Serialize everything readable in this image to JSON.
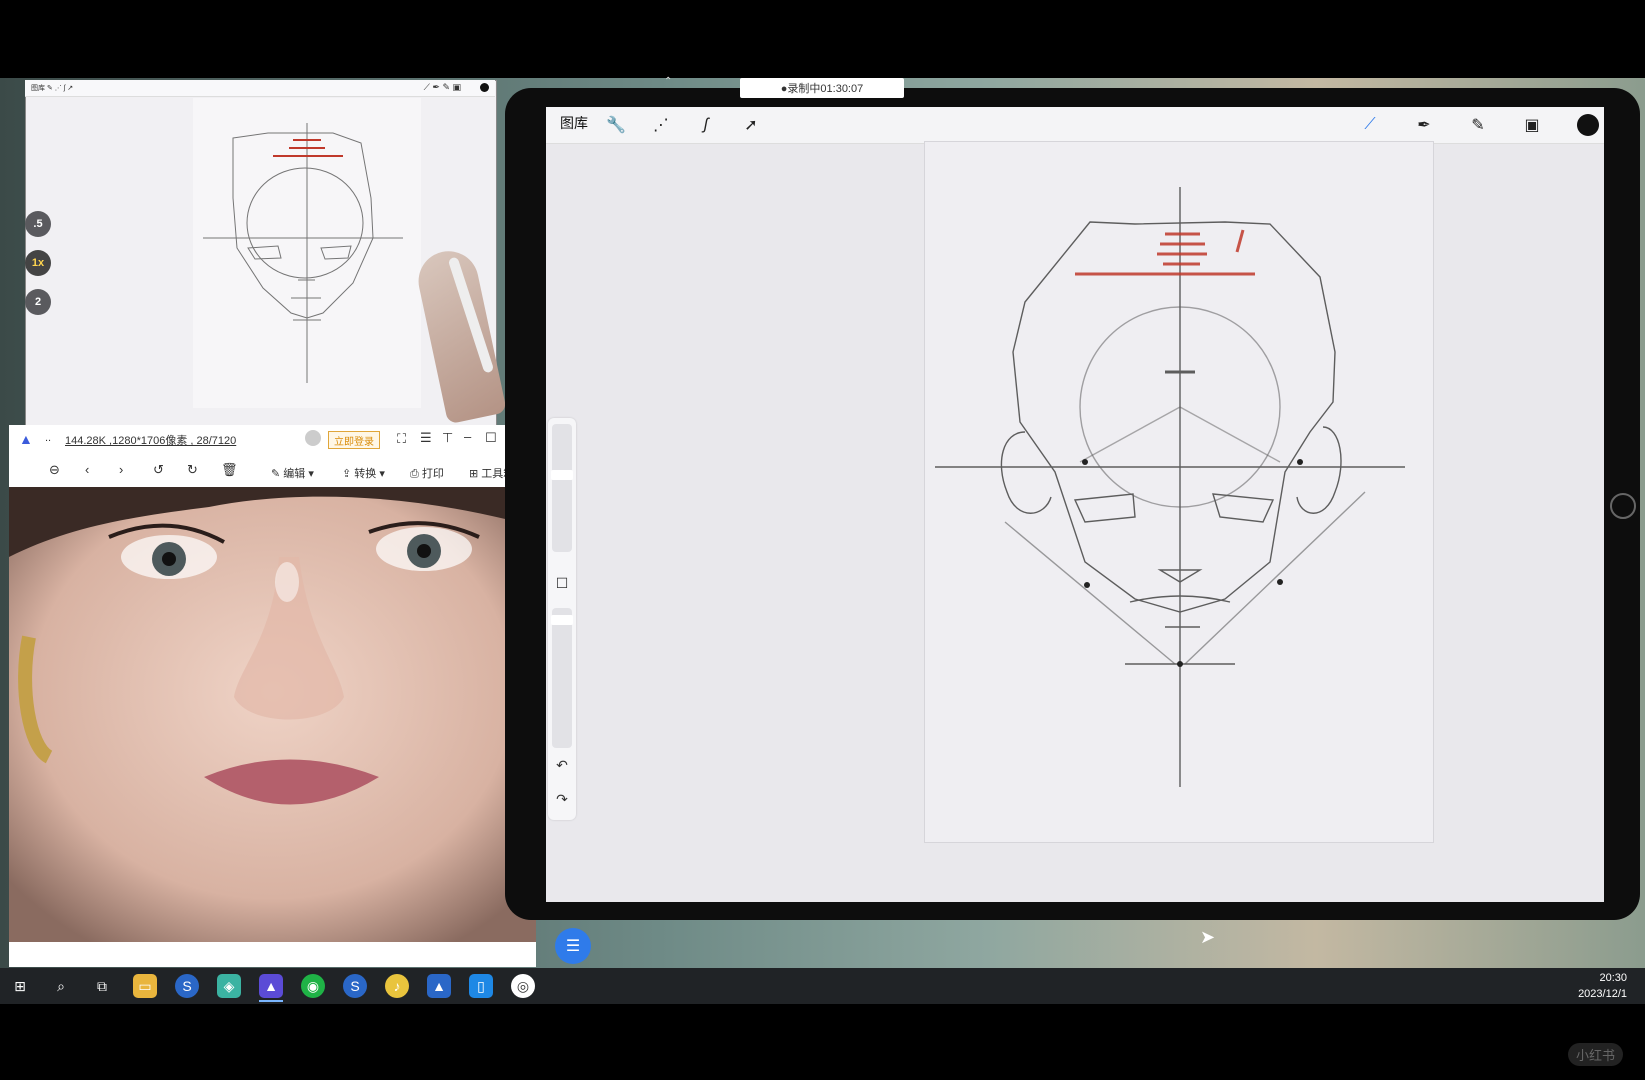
{
  "recording": {
    "label": "●录制中01:30:07"
  },
  "procreate": {
    "gallery": "图库",
    "left_tools": [
      "wrench-icon",
      "magic-wand-icon",
      "selection-icon",
      "transform-arrow-icon"
    ],
    "right_tools": [
      "brush-icon",
      "smudge-icon",
      "eraser-icon",
      "layers-icon",
      "color-icon"
    ]
  },
  "mini_view": {
    "zoom_buttons": [
      ".5",
      "1x",
      "2"
    ],
    "active_zoom": "1x"
  },
  "viewer": {
    "title": "144.28K ,1280*1706像素 , 28/7120",
    "dots": "..",
    "login": "立即登录",
    "edit": "编辑",
    "convert": "转换",
    "print": "打印",
    "toolbox": "工具箱"
  },
  "taskbar": {
    "time": "20:30",
    "date": "2023/12/1"
  },
  "watermark": "小红书",
  "colors": {
    "accent": "#2f7bea",
    "sketch_red": "#c0392b"
  }
}
